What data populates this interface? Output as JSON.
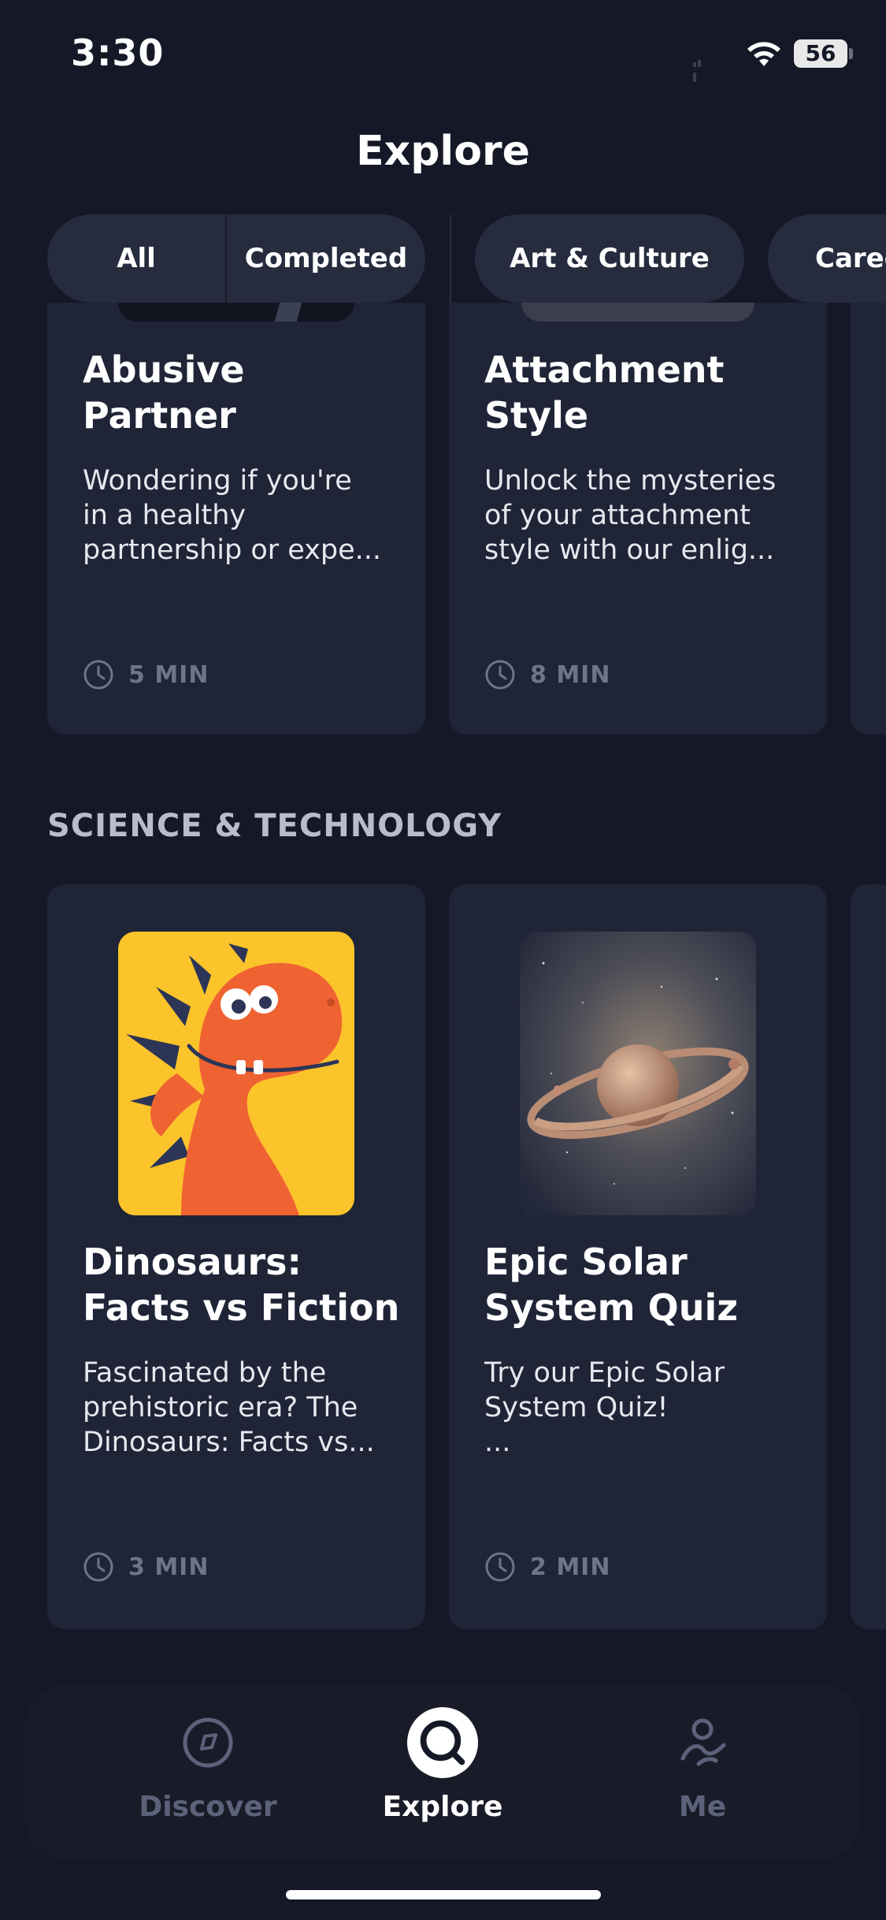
{
  "status_bar": {
    "time": "3:30",
    "battery": "56"
  },
  "page_title": "Explore",
  "filters": {
    "segments": [
      "All",
      "Completed"
    ],
    "chips": [
      "Art & Culture",
      "Caree"
    ]
  },
  "top_cards": [
    {
      "title_line1": "Abusive",
      "title_line2": "Partner",
      "desc_line1": "Wondering if you're",
      "desc_line2": "in a healthy",
      "desc_line3": "partnership or expe...",
      "duration": "5 MIN"
    },
    {
      "title_line1": "Attachment",
      "title_line2": "Style",
      "desc_line1": "Unlock the mysteries",
      "desc_line2": "of your attachment",
      "desc_line3": "style with our enlig...",
      "duration": "8 MIN"
    }
  ],
  "section": {
    "heading": "SCIENCE & TECHNOLOGY"
  },
  "science_cards": [
    {
      "image": "cartoon-orange-dinosaur",
      "title_line1": "Dinosaurs:",
      "title_line2": "Facts vs Fiction",
      "desc_line1": "Fascinated by the",
      "desc_line2": "prehistoric era? The",
      "desc_line3": "Dinosaurs: Facts vs...",
      "duration": "3 MIN"
    },
    {
      "image": "ringed-planet-in-space",
      "title_line1": "Epic Solar",
      "title_line2": "System Quiz",
      "desc_line1": "Try our Epic Solar",
      "desc_line2": "System Quiz!",
      "desc_line3": "...",
      "duration": "2 MIN"
    }
  ],
  "bottom_nav": {
    "items": [
      {
        "label": "Discover",
        "icon": "compass-icon",
        "active": false
      },
      {
        "label": "Explore",
        "icon": "search-icon",
        "active": true
      },
      {
        "label": "Me",
        "icon": "person-icon",
        "active": false
      }
    ]
  },
  "colors": {
    "background": "#141827",
    "card": "#1f2436",
    "chip": "#262b3e",
    "muted": "#6e7489",
    "dino_bg": "#fcc42b",
    "dino": "#ef6232"
  }
}
